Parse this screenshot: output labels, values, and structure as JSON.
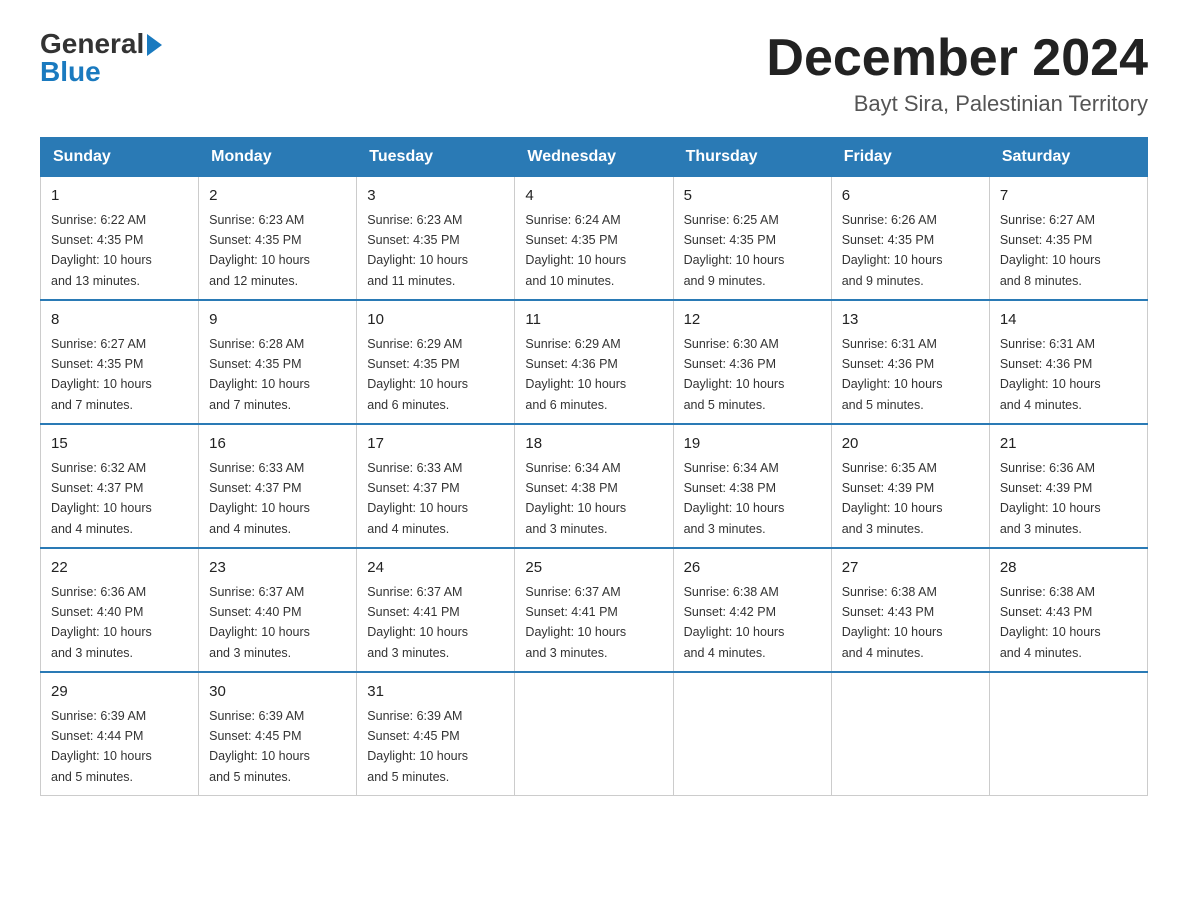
{
  "logo": {
    "general": "General",
    "blue": "Blue",
    "arrow": "▶"
  },
  "title": {
    "month": "December 2024",
    "location": "Bayt Sira, Palestinian Territory"
  },
  "headers": [
    "Sunday",
    "Monday",
    "Tuesday",
    "Wednesday",
    "Thursday",
    "Friday",
    "Saturday"
  ],
  "weeks": [
    [
      {
        "day": "1",
        "sunrise": "6:22 AM",
        "sunset": "4:35 PM",
        "daylight": "10 hours and 13 minutes."
      },
      {
        "day": "2",
        "sunrise": "6:23 AM",
        "sunset": "4:35 PM",
        "daylight": "10 hours and 12 minutes."
      },
      {
        "day": "3",
        "sunrise": "6:23 AM",
        "sunset": "4:35 PM",
        "daylight": "10 hours and 11 minutes."
      },
      {
        "day": "4",
        "sunrise": "6:24 AM",
        "sunset": "4:35 PM",
        "daylight": "10 hours and 10 minutes."
      },
      {
        "day": "5",
        "sunrise": "6:25 AM",
        "sunset": "4:35 PM",
        "daylight": "10 hours and 9 minutes."
      },
      {
        "day": "6",
        "sunrise": "6:26 AM",
        "sunset": "4:35 PM",
        "daylight": "10 hours and 9 minutes."
      },
      {
        "day": "7",
        "sunrise": "6:27 AM",
        "sunset": "4:35 PM",
        "daylight": "10 hours and 8 minutes."
      }
    ],
    [
      {
        "day": "8",
        "sunrise": "6:27 AM",
        "sunset": "4:35 PM",
        "daylight": "10 hours and 7 minutes."
      },
      {
        "day": "9",
        "sunrise": "6:28 AM",
        "sunset": "4:35 PM",
        "daylight": "10 hours and 7 minutes."
      },
      {
        "day": "10",
        "sunrise": "6:29 AM",
        "sunset": "4:35 PM",
        "daylight": "10 hours and 6 minutes."
      },
      {
        "day": "11",
        "sunrise": "6:29 AM",
        "sunset": "4:36 PM",
        "daylight": "10 hours and 6 minutes."
      },
      {
        "day": "12",
        "sunrise": "6:30 AM",
        "sunset": "4:36 PM",
        "daylight": "10 hours and 5 minutes."
      },
      {
        "day": "13",
        "sunrise": "6:31 AM",
        "sunset": "4:36 PM",
        "daylight": "10 hours and 5 minutes."
      },
      {
        "day": "14",
        "sunrise": "6:31 AM",
        "sunset": "4:36 PM",
        "daylight": "10 hours and 4 minutes."
      }
    ],
    [
      {
        "day": "15",
        "sunrise": "6:32 AM",
        "sunset": "4:37 PM",
        "daylight": "10 hours and 4 minutes."
      },
      {
        "day": "16",
        "sunrise": "6:33 AM",
        "sunset": "4:37 PM",
        "daylight": "10 hours and 4 minutes."
      },
      {
        "day": "17",
        "sunrise": "6:33 AM",
        "sunset": "4:37 PM",
        "daylight": "10 hours and 4 minutes."
      },
      {
        "day": "18",
        "sunrise": "6:34 AM",
        "sunset": "4:38 PM",
        "daylight": "10 hours and 3 minutes."
      },
      {
        "day": "19",
        "sunrise": "6:34 AM",
        "sunset": "4:38 PM",
        "daylight": "10 hours and 3 minutes."
      },
      {
        "day": "20",
        "sunrise": "6:35 AM",
        "sunset": "4:39 PM",
        "daylight": "10 hours and 3 minutes."
      },
      {
        "day": "21",
        "sunrise": "6:36 AM",
        "sunset": "4:39 PM",
        "daylight": "10 hours and 3 minutes."
      }
    ],
    [
      {
        "day": "22",
        "sunrise": "6:36 AM",
        "sunset": "4:40 PM",
        "daylight": "10 hours and 3 minutes."
      },
      {
        "day": "23",
        "sunrise": "6:37 AM",
        "sunset": "4:40 PM",
        "daylight": "10 hours and 3 minutes."
      },
      {
        "day": "24",
        "sunrise": "6:37 AM",
        "sunset": "4:41 PM",
        "daylight": "10 hours and 3 minutes."
      },
      {
        "day": "25",
        "sunrise": "6:37 AM",
        "sunset": "4:41 PM",
        "daylight": "10 hours and 3 minutes."
      },
      {
        "day": "26",
        "sunrise": "6:38 AM",
        "sunset": "4:42 PM",
        "daylight": "10 hours and 4 minutes."
      },
      {
        "day": "27",
        "sunrise": "6:38 AM",
        "sunset": "4:43 PM",
        "daylight": "10 hours and 4 minutes."
      },
      {
        "day": "28",
        "sunrise": "6:38 AM",
        "sunset": "4:43 PM",
        "daylight": "10 hours and 4 minutes."
      }
    ],
    [
      {
        "day": "29",
        "sunrise": "6:39 AM",
        "sunset": "4:44 PM",
        "daylight": "10 hours and 5 minutes."
      },
      {
        "day": "30",
        "sunrise": "6:39 AM",
        "sunset": "4:45 PM",
        "daylight": "10 hours and 5 minutes."
      },
      {
        "day": "31",
        "sunrise": "6:39 AM",
        "sunset": "4:45 PM",
        "daylight": "10 hours and 5 minutes."
      },
      null,
      null,
      null,
      null
    ]
  ],
  "labels": {
    "sunrise": "Sunrise:",
    "sunset": "Sunset:",
    "daylight": "Daylight:"
  }
}
